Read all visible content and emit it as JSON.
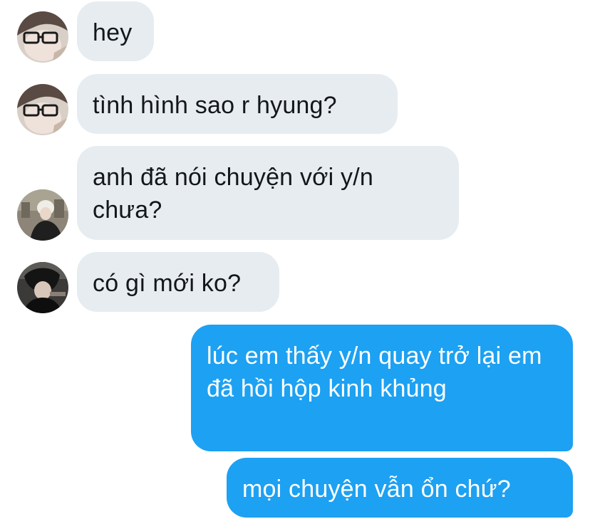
{
  "messages": [
    {
      "side": "incoming",
      "avatar": "glasses-boy-avatar",
      "text": "hey"
    },
    {
      "side": "incoming",
      "avatar": "glasses-boy-avatar",
      "text": "tình hình sao r hyung?"
    },
    {
      "side": "incoming",
      "avatar": "blond-boy-avatar",
      "text": "anh đã nói chuyện với y/n chưa?"
    },
    {
      "side": "incoming",
      "avatar": "dark-hair-boy-avatar",
      "text": "có gì mới ko?"
    },
    {
      "side": "outgoing",
      "text": "lúc em thấy y/n quay trở lại em đã hồi hộp kinh khủng"
    },
    {
      "side": "outgoing",
      "text": "mọi chuyện vẫn ổn chứ?"
    }
  ],
  "colors": {
    "incoming_bubble": "#e6ecf0",
    "outgoing_bubble": "#1da1f2"
  }
}
